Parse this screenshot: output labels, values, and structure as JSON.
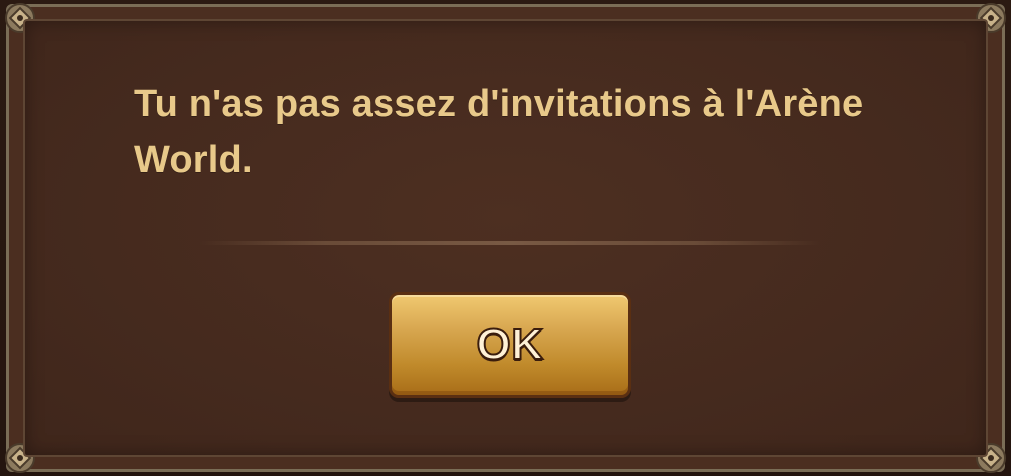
{
  "dialog": {
    "message": "Tu n'as pas assez d'invitations à l'Arène World.",
    "ok_label": "OK"
  },
  "colors": {
    "text_gold": "#e8c98a",
    "panel_brown": "#452a1e",
    "frame_border": "#7a6d56",
    "button_gold": "#d7a64f"
  },
  "icons": {
    "corner": "ornament-corner-icon"
  }
}
